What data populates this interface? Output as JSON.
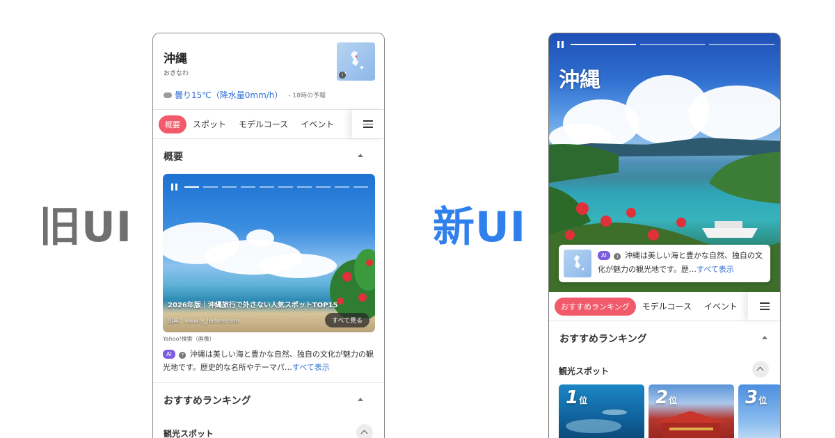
{
  "labels": {
    "old": "旧UI",
    "new": "新UI"
  },
  "old_ui": {
    "title": "沖縄",
    "reading": "おきなわ",
    "weather": "曇り15℃（降水量0mm/h）",
    "forecast": "- 18時の予報",
    "tabs": [
      "概要",
      "スポット",
      "モデルコース",
      "イベント"
    ],
    "section_title": "概要",
    "hero_caption": "2026年版｜沖縄旅行で外さない人気スポットTOP15",
    "hero_source": "出典：www.ly_leisure.com",
    "see_all": "すべて見る",
    "image_credit": "Yahoo!検索（画像）",
    "ai_badge": "AI",
    "ai_text": "沖縄は美しい海と豊かな自然、独自の文化が魅力の観光地です。歴史的な名所やテーマパ…",
    "ai_more": "すべて表示",
    "ranking_title": "おすすめランキング",
    "spots_label": "観光スポット"
  },
  "new_ui": {
    "title": "沖縄",
    "ai_badge": "AI",
    "ai_text": "沖縄は美しい海と豊かな自然、独自の文化が魅力の観光地です。歴…",
    "ai_more": "すべて表示",
    "tabs": [
      "おすすめランキング",
      "モデルコース",
      "イベント"
    ],
    "ranking_title": "おすすめランキング",
    "spots_label": "観光スポット",
    "rank_cards": [
      {
        "rank": "1",
        "suffix": "位"
      },
      {
        "rank": "2",
        "suffix": "位"
      },
      {
        "rank": "3",
        "suffix": "位"
      }
    ]
  },
  "colors": {
    "accent_pink": "#f05a6a",
    "link_blue": "#2f6fd6",
    "new_label_blue": "#2f80ed",
    "ai_purple": "#7b5ce0"
  }
}
